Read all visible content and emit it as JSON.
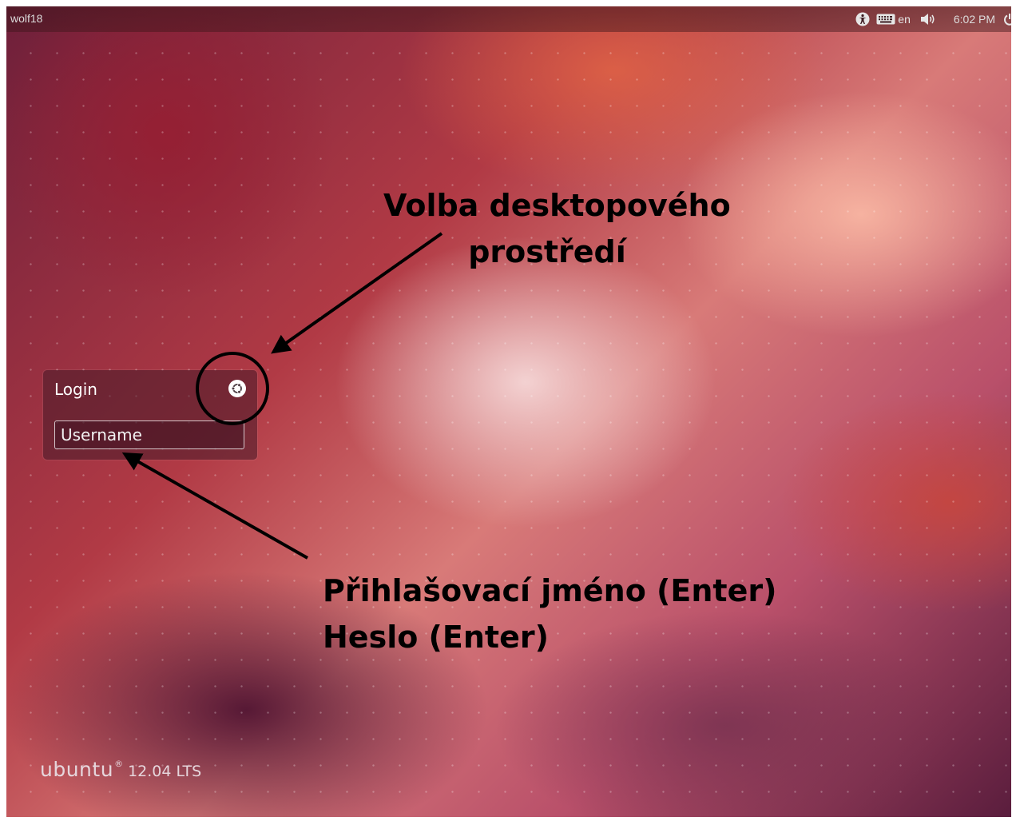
{
  "panel": {
    "hostname": "wolf18",
    "keyboard_layout": "en",
    "clock": "6:02 PM",
    "icons": [
      "accessibility-icon",
      "keyboard-icon",
      "volume-icon",
      "power-icon"
    ]
  },
  "login": {
    "title": "Login",
    "username_placeholder": "Username",
    "session_icon": "ubuntu-session-icon"
  },
  "brand": {
    "name": "ubuntu",
    "registered": "®",
    "version": "12.04 LTS"
  },
  "annotations": {
    "session_line1": "Volba desktopového",
    "session_line2": "prostředí",
    "login_line1": "Přihlašovací jméno (Enter)",
    "login_line2": "Heslo (Enter)"
  },
  "colors": {
    "annotation": "#000000",
    "panel_text": "#dcdcdc",
    "ubuntu_orange": "#dd4814"
  }
}
